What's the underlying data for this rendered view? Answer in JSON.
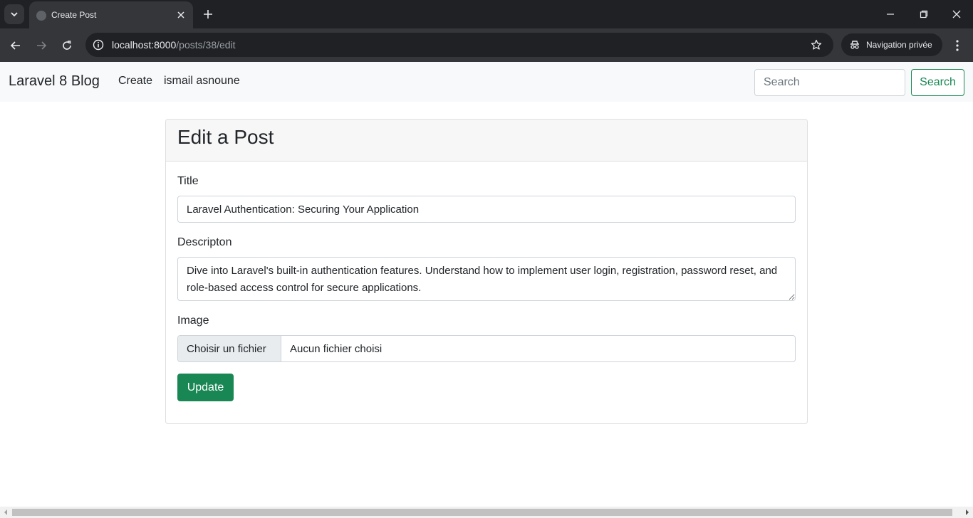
{
  "browser": {
    "tab_title": "Create Post",
    "url_host": "localhost:8000",
    "url_path": "/posts/38/edit",
    "incognito_label": "Navigation privée"
  },
  "navbar": {
    "brand": "Laravel 8 Blog",
    "links": [
      "Create",
      "ismail asnoune"
    ],
    "search_placeholder": "Search",
    "search_button": "Search"
  },
  "card": {
    "title": "Edit a Post",
    "title_label": "Title",
    "title_value": "Laravel Authentication: Securing Your Application",
    "description_label": "Descripton",
    "description_value": "Dive into Laravel's built-in authentication features. Understand how to implement user login, registration, password reset, and role-based access control for secure applications.",
    "image_label": "Image",
    "file_button": "Choisir un fichier",
    "file_status": "Aucun fichier choisi",
    "submit_button": "Update"
  },
  "colors": {
    "success": "#198754",
    "navbar_bg": "#f8f9fa",
    "chrome_dark": "#202124",
    "chrome_toolbar": "#35363a"
  }
}
